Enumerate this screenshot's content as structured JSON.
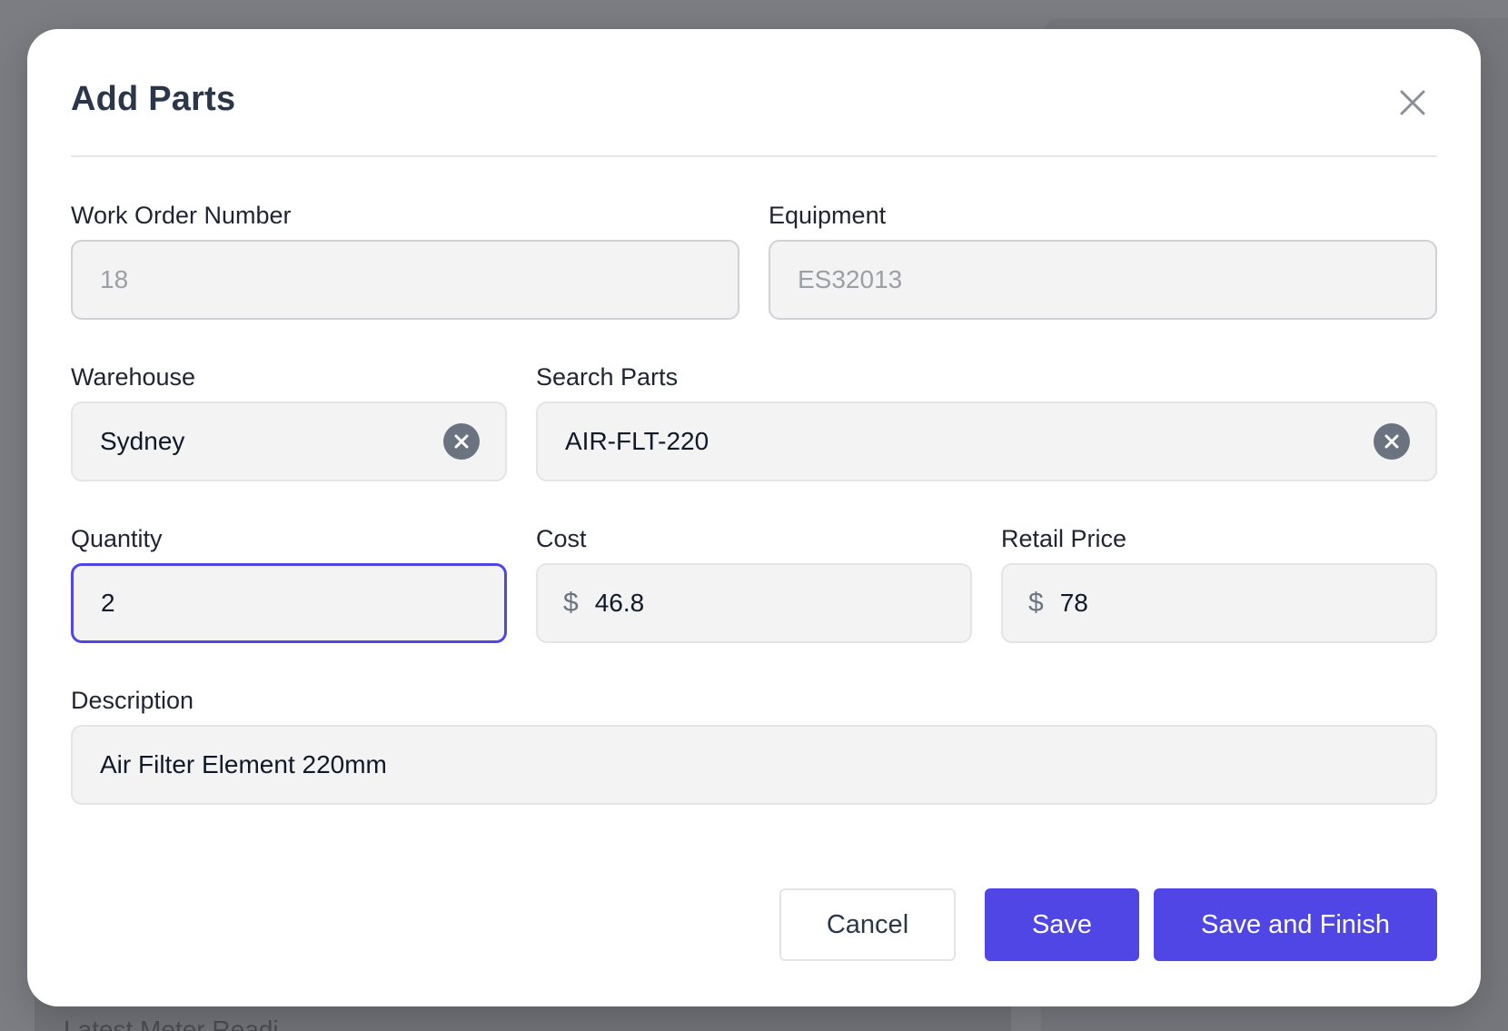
{
  "background": {
    "partial_text": "Latest Meter Readi..."
  },
  "modal": {
    "title": "Add Parts",
    "close_icon": "close-icon"
  },
  "form": {
    "work_order": {
      "label": "Work Order Number",
      "value": "18"
    },
    "equipment": {
      "label": "Equipment",
      "value": "ES32013"
    },
    "warehouse": {
      "label": "Warehouse",
      "value": "Sydney"
    },
    "search_parts": {
      "label": "Search Parts",
      "value": "AIR-FLT-220"
    },
    "quantity": {
      "label": "Quantity",
      "value": "2"
    },
    "cost": {
      "label": "Cost",
      "currency": "$",
      "value": "46.8"
    },
    "retail_price": {
      "label": "Retail Price",
      "currency": "$",
      "value": "78"
    },
    "description": {
      "label": "Description",
      "value": "Air Filter Element 220mm"
    }
  },
  "actions": {
    "cancel": "Cancel",
    "save": "Save",
    "save_finish": "Save and Finish"
  },
  "colors": {
    "primary": "#4f46e5",
    "overlay": "#7b7d82",
    "field_bg": "#f3f3f4"
  }
}
